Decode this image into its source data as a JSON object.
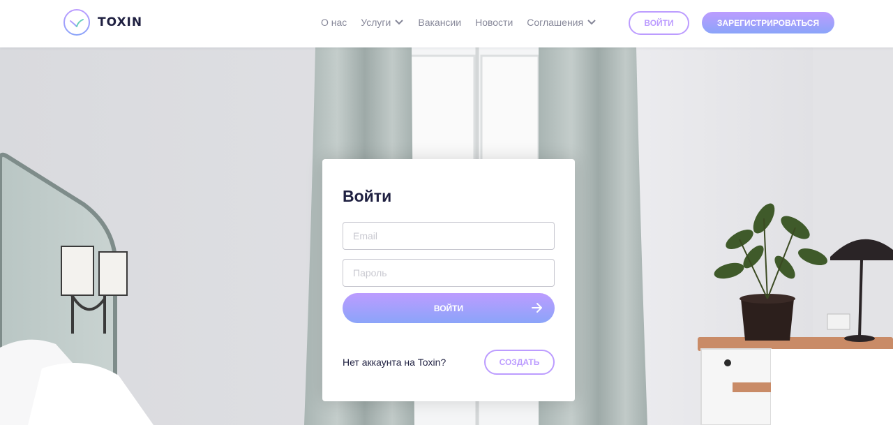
{
  "header": {
    "logo_text": "TOXIN",
    "nav": [
      {
        "label": "О нас",
        "has_dropdown": false
      },
      {
        "label": "Услуги",
        "has_dropdown": true
      },
      {
        "label": "Вакансии",
        "has_dropdown": false
      },
      {
        "label": "Новости",
        "has_dropdown": false
      },
      {
        "label": "Соглашения",
        "has_dropdown": true
      }
    ],
    "login_label": "войти",
    "register_label": "зарегистрироваться"
  },
  "login_card": {
    "title": "Войти",
    "email_placeholder": "Email",
    "password_placeholder": "Пароль",
    "submit_label": "войти",
    "no_account_text": "Нет аккаунта на Toxin?",
    "create_label": "создать"
  },
  "colors": {
    "accent_purple": "#bc9cff",
    "accent_blue": "#8ba4f9",
    "dark_text": "#1f2041",
    "logo_green": "#6fcf97"
  },
  "icons": {
    "logo": "toxin-logo-icon",
    "dropdown": "chevron-down-icon",
    "submit": "arrow-right-icon"
  }
}
